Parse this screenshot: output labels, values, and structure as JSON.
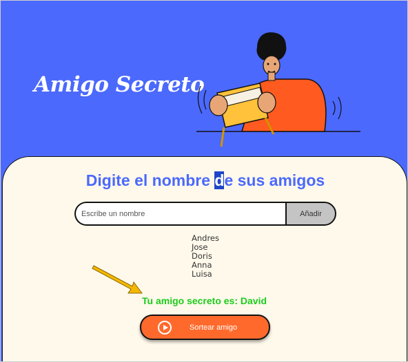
{
  "header": {
    "title": "Amigo Secreto"
  },
  "main": {
    "heading_before": "Digite el nombre ",
    "heading_highlight": "d",
    "heading_after": "e sus amigos",
    "input": {
      "placeholder": "Escribe un nombre",
      "value": ""
    },
    "add_label": "Añadir",
    "friends": [
      "Andres",
      "Jose",
      "Doris",
      "Anna",
      "Luisa"
    ],
    "result": "Tu amigo secreto es: David",
    "draw_label": "Sortear amigo"
  },
  "colors": {
    "hero_bg": "#4b69fd",
    "panel_bg": "#fff9eb",
    "heading": "#4b69fd",
    "result": "#1bcc1b",
    "draw_button": "#ff6a2c",
    "add_button": "#c4c4c4",
    "arrow": "#f5b800"
  },
  "icons": {
    "illustration": "person-holding-box-illustration",
    "arrow": "arrow-icon",
    "play": "play-circle-icon"
  }
}
